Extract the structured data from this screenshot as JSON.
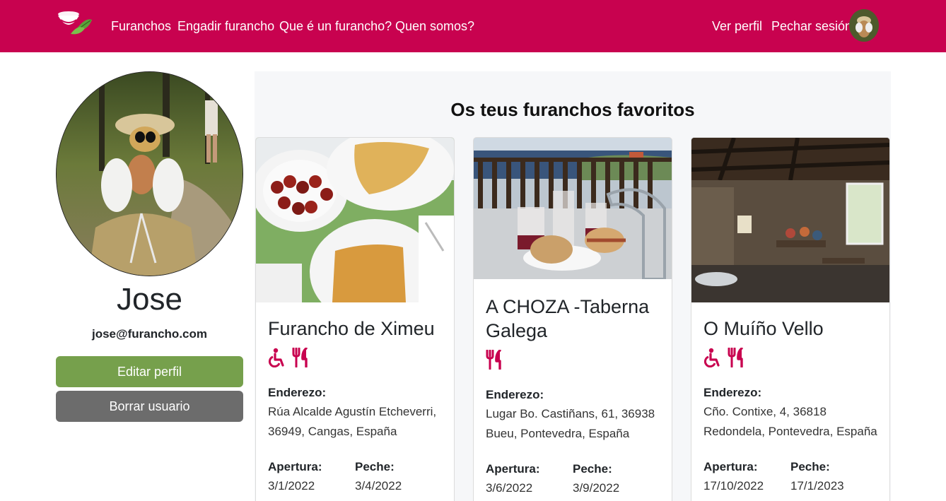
{
  "nav": {
    "links": [
      "Furanchos",
      "Engadir furancho",
      "Que é un furancho?",
      "Quen somos?"
    ],
    "right_links": [
      "Ver perfil",
      "Pechar sesión"
    ]
  },
  "profile": {
    "name": "Jose",
    "email": "jose@furancho.com",
    "edit_label": "Editar perfil",
    "delete_label": "Borrar usuario"
  },
  "favorites": {
    "title": "Os teus furanchos favoritos",
    "address_label": "Enderezo:",
    "opening_label": "Apertura:",
    "closing_label": "Peche:",
    "cards": [
      {
        "name": "Furancho de Ximeu",
        "icons": [
          "wheelchair-icon",
          "utensils-icon"
        ],
        "address_line1": "Rúa Alcalde Agustín Etcheverri,",
        "address_line2": "36949, Cangas, España",
        "opening": "3/1/2022",
        "closing": "3/4/2022"
      },
      {
        "name_line1": "A CHOZA -Taberna",
        "name_line2": "Galega",
        "icons": [
          "utensils-icon"
        ],
        "address_line1": "Lugar Bo. Castiñans, 61, 36938",
        "address_line2": "Bueu, Pontevedra, España",
        "opening": "3/6/2022",
        "closing": "3/9/2022"
      },
      {
        "name": "O Muíño Vello",
        "icons": [
          "wheelchair-icon",
          "utensils-icon"
        ],
        "address_line1": "Cño. Contixe, 4, 36818",
        "address_line2": "Redondela, Pontevedra, España",
        "opening": "17/10/2022",
        "closing": "17/1/2023"
      }
    ]
  },
  "colors": {
    "brand": "#c8024f",
    "edit_button": "#76a04c",
    "delete_button": "#6c6c6c",
    "icon": "#c8024f"
  }
}
